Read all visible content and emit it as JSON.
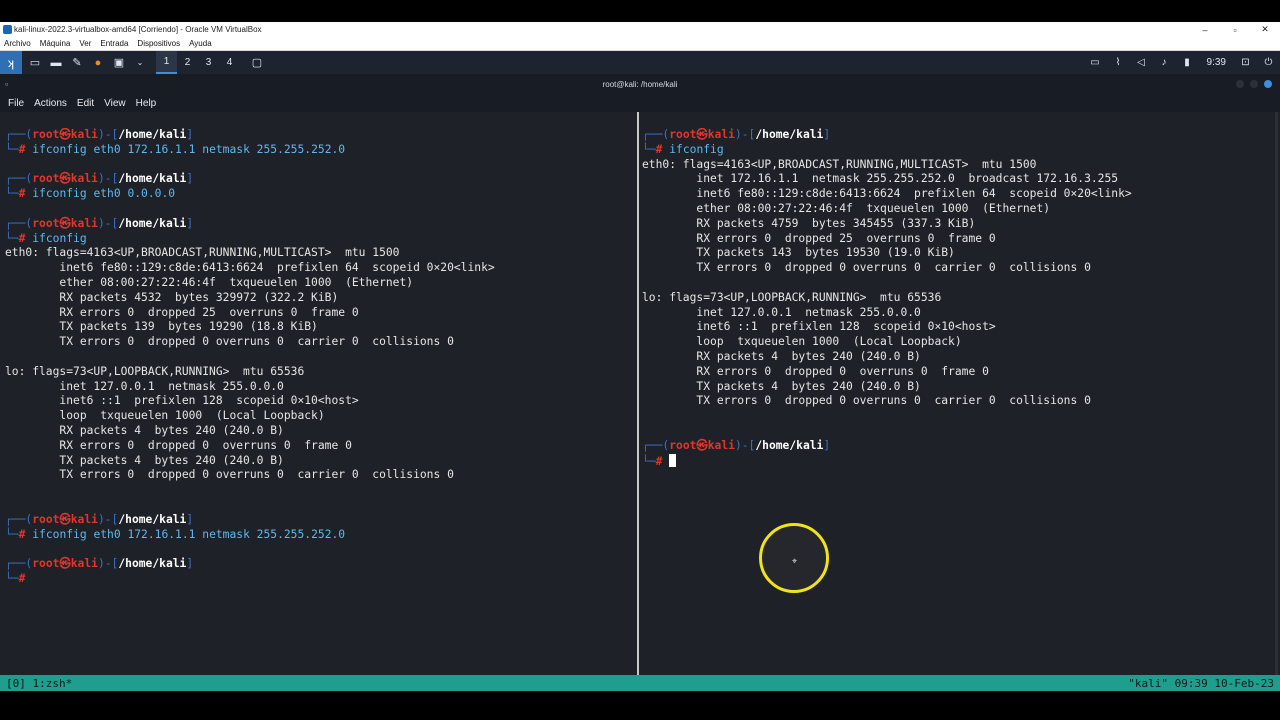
{
  "vbox": {
    "title": "kali-linux-2022.3-virtualbox-amd64 [Corriendo] - Oracle VM VirtualBox",
    "menu": [
      "Archivo",
      "Máquina",
      "Ver",
      "Entrada",
      "Dispositivos",
      "Ayuda"
    ]
  },
  "panel": {
    "workspaces": [
      "1",
      "2",
      "3",
      "4"
    ],
    "clock": "9:39",
    "icons": [
      "kali-menu-icon",
      "desktop-icon",
      "file-manager-icon",
      "text-editor-icon",
      "firefox-icon",
      "terminal-icon",
      "screenshot-icon"
    ]
  },
  "terminal": {
    "window_title": "root@kali: /home/kali",
    "menu": [
      "File",
      "Actions",
      "Edit",
      "View",
      "Help"
    ]
  },
  "prompt": {
    "user_host": "root㉿kali",
    "path": "/home/kali",
    "symbol": "#"
  },
  "left_pane": [
    {
      "type": "prompt"
    },
    {
      "type": "cmd",
      "text": "ifconfig eth0 172.16.1.1 netmask 255.255.252.0"
    },
    {
      "type": "blank"
    },
    {
      "type": "prompt"
    },
    {
      "type": "cmd",
      "text": "ifconfig eth0 0.0.0.0"
    },
    {
      "type": "blank"
    },
    {
      "type": "prompt"
    },
    {
      "type": "cmd",
      "text": "ifconfig"
    },
    {
      "type": "out",
      "text": "eth0: flags=4163<UP,BROADCAST,RUNNING,MULTICAST>  mtu 1500"
    },
    {
      "type": "out",
      "text": "        inet6 fe80::129:c8de:6413:6624  prefixlen 64  scopeid 0×20<link>"
    },
    {
      "type": "out",
      "text": "        ether 08:00:27:22:46:4f  txqueuelen 1000  (Ethernet)"
    },
    {
      "type": "out",
      "text": "        RX packets 4532  bytes 329972 (322.2 KiB)"
    },
    {
      "type": "out",
      "text": "        RX errors 0  dropped 25  overruns 0  frame 0"
    },
    {
      "type": "out",
      "text": "        TX packets 139  bytes 19290 (18.8 KiB)"
    },
    {
      "type": "out",
      "text": "        TX errors 0  dropped 0 overruns 0  carrier 0  collisions 0"
    },
    {
      "type": "blank"
    },
    {
      "type": "out",
      "text": "lo: flags=73<UP,LOOPBACK,RUNNING>  mtu 65536"
    },
    {
      "type": "out",
      "text": "        inet 127.0.0.1  netmask 255.0.0.0"
    },
    {
      "type": "out",
      "text": "        inet6 ::1  prefixlen 128  scopeid 0×10<host>"
    },
    {
      "type": "out",
      "text": "        loop  txqueuelen 1000  (Local Loopback)"
    },
    {
      "type": "out",
      "text": "        RX packets 4  bytes 240 (240.0 B)"
    },
    {
      "type": "out",
      "text": "        RX errors 0  dropped 0  overruns 0  frame 0"
    },
    {
      "type": "out",
      "text": "        TX packets 4  bytes 240 (240.0 B)"
    },
    {
      "type": "out",
      "text": "        TX errors 0  dropped 0 overruns 0  carrier 0  collisions 0"
    },
    {
      "type": "blank"
    },
    {
      "type": "blank"
    },
    {
      "type": "prompt"
    },
    {
      "type": "cmd",
      "text": "ifconfig eth0 172.16.1.1 netmask 255.255.252.0"
    },
    {
      "type": "blank"
    },
    {
      "type": "prompt"
    },
    {
      "type": "cmd",
      "text": ""
    }
  ],
  "right_pane": [
    {
      "type": "prompt"
    },
    {
      "type": "cmd",
      "text": "ifconfig"
    },
    {
      "type": "out",
      "text": "eth0: flags=4163<UP,BROADCAST,RUNNING,MULTICAST>  mtu 1500"
    },
    {
      "type": "out",
      "text": "        inet 172.16.1.1  netmask 255.255.252.0  broadcast 172.16.3.255"
    },
    {
      "type": "out",
      "text": "        inet6 fe80::129:c8de:6413:6624  prefixlen 64  scopeid 0×20<link>"
    },
    {
      "type": "out",
      "text": "        ether 08:00:27:22:46:4f  txqueuelen 1000  (Ethernet)"
    },
    {
      "type": "out",
      "text": "        RX packets 4759  bytes 345455 (337.3 KiB)"
    },
    {
      "type": "out",
      "text": "        RX errors 0  dropped 25  overruns 0  frame 0"
    },
    {
      "type": "out",
      "text": "        TX packets 143  bytes 19530 (19.0 KiB)"
    },
    {
      "type": "out",
      "text": "        TX errors 0  dropped 0 overruns 0  carrier 0  collisions 0"
    },
    {
      "type": "blank"
    },
    {
      "type": "out",
      "text": "lo: flags=73<UP,LOOPBACK,RUNNING>  mtu 65536"
    },
    {
      "type": "out",
      "text": "        inet 127.0.0.1  netmask 255.0.0.0"
    },
    {
      "type": "out",
      "text": "        inet6 ::1  prefixlen 128  scopeid 0×10<host>"
    },
    {
      "type": "out",
      "text": "        loop  txqueuelen 1000  (Local Loopback)"
    },
    {
      "type": "out",
      "text": "        RX packets 4  bytes 240 (240.0 B)"
    },
    {
      "type": "out",
      "text": "        RX errors 0  dropped 0  overruns 0  frame 0"
    },
    {
      "type": "out",
      "text": "        TX packets 4  bytes 240 (240.0 B)"
    },
    {
      "type": "out",
      "text": "        TX errors 0  dropped 0 overruns 0  carrier 0  collisions 0"
    },
    {
      "type": "blank"
    },
    {
      "type": "blank"
    },
    {
      "type": "prompt"
    },
    {
      "type": "cursor"
    }
  ],
  "tmux": {
    "left": "[0] 1:zsh*",
    "right": "\"kali\" 09:39 10-Feb-23"
  },
  "colors": {
    "terminal_bg": "#1e2127",
    "prompt_frame": "#3a73c4",
    "prompt_user": "#e0362c",
    "command": "#5fb8f0",
    "tmux_bar": "#1f9e8e",
    "mouse_ring": "#f1e31b"
  }
}
